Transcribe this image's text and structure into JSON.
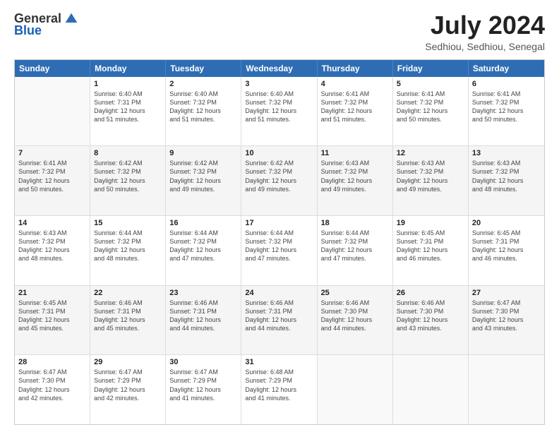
{
  "logo": {
    "general": "General",
    "blue": "Blue"
  },
  "header": {
    "month_year": "July 2024",
    "location": "Sedhiou, Sedhiou, Senegal"
  },
  "days_of_week": [
    "Sunday",
    "Monday",
    "Tuesday",
    "Wednesday",
    "Thursday",
    "Friday",
    "Saturday"
  ],
  "weeks": [
    [
      {
        "day": "",
        "empty": true
      },
      {
        "day": "1",
        "sunrise": "Sunrise: 6:40 AM",
        "sunset": "Sunset: 7:31 PM",
        "daylight": "Daylight: 12 hours and 51 minutes."
      },
      {
        "day": "2",
        "sunrise": "Sunrise: 6:40 AM",
        "sunset": "Sunset: 7:32 PM",
        "daylight": "Daylight: 12 hours and 51 minutes."
      },
      {
        "day": "3",
        "sunrise": "Sunrise: 6:40 AM",
        "sunset": "Sunset: 7:32 PM",
        "daylight": "Daylight: 12 hours and 51 minutes."
      },
      {
        "day": "4",
        "sunrise": "Sunrise: 6:41 AM",
        "sunset": "Sunset: 7:32 PM",
        "daylight": "Daylight: 12 hours and 51 minutes."
      },
      {
        "day": "5",
        "sunrise": "Sunrise: 6:41 AM",
        "sunset": "Sunset: 7:32 PM",
        "daylight": "Daylight: 12 hours and 50 minutes."
      },
      {
        "day": "6",
        "sunrise": "Sunrise: 6:41 AM",
        "sunset": "Sunset: 7:32 PM",
        "daylight": "Daylight: 12 hours and 50 minutes."
      }
    ],
    [
      {
        "day": "7",
        "sunrise": "Sunrise: 6:41 AM",
        "sunset": "Sunset: 7:32 PM",
        "daylight": "Daylight: 12 hours and 50 minutes."
      },
      {
        "day": "8",
        "sunrise": "Sunrise: 6:42 AM",
        "sunset": "Sunset: 7:32 PM",
        "daylight": "Daylight: 12 hours and 50 minutes."
      },
      {
        "day": "9",
        "sunrise": "Sunrise: 6:42 AM",
        "sunset": "Sunset: 7:32 PM",
        "daylight": "Daylight: 12 hours and 49 minutes."
      },
      {
        "day": "10",
        "sunrise": "Sunrise: 6:42 AM",
        "sunset": "Sunset: 7:32 PM",
        "daylight": "Daylight: 12 hours and 49 minutes."
      },
      {
        "day": "11",
        "sunrise": "Sunrise: 6:43 AM",
        "sunset": "Sunset: 7:32 PM",
        "daylight": "Daylight: 12 hours and 49 minutes."
      },
      {
        "day": "12",
        "sunrise": "Sunrise: 6:43 AM",
        "sunset": "Sunset: 7:32 PM",
        "daylight": "Daylight: 12 hours and 49 minutes."
      },
      {
        "day": "13",
        "sunrise": "Sunrise: 6:43 AM",
        "sunset": "Sunset: 7:32 PM",
        "daylight": "Daylight: 12 hours and 48 minutes."
      }
    ],
    [
      {
        "day": "14",
        "sunrise": "Sunrise: 6:43 AM",
        "sunset": "Sunset: 7:32 PM",
        "daylight": "Daylight: 12 hours and 48 minutes."
      },
      {
        "day": "15",
        "sunrise": "Sunrise: 6:44 AM",
        "sunset": "Sunset: 7:32 PM",
        "daylight": "Daylight: 12 hours and 48 minutes."
      },
      {
        "day": "16",
        "sunrise": "Sunrise: 6:44 AM",
        "sunset": "Sunset: 7:32 PM",
        "daylight": "Daylight: 12 hours and 47 minutes."
      },
      {
        "day": "17",
        "sunrise": "Sunrise: 6:44 AM",
        "sunset": "Sunset: 7:32 PM",
        "daylight": "Daylight: 12 hours and 47 minutes."
      },
      {
        "day": "18",
        "sunrise": "Sunrise: 6:44 AM",
        "sunset": "Sunset: 7:32 PM",
        "daylight": "Daylight: 12 hours and 47 minutes."
      },
      {
        "day": "19",
        "sunrise": "Sunrise: 6:45 AM",
        "sunset": "Sunset: 7:31 PM",
        "daylight": "Daylight: 12 hours and 46 minutes."
      },
      {
        "day": "20",
        "sunrise": "Sunrise: 6:45 AM",
        "sunset": "Sunset: 7:31 PM",
        "daylight": "Daylight: 12 hours and 46 minutes."
      }
    ],
    [
      {
        "day": "21",
        "sunrise": "Sunrise: 6:45 AM",
        "sunset": "Sunset: 7:31 PM",
        "daylight": "Daylight: 12 hours and 45 minutes."
      },
      {
        "day": "22",
        "sunrise": "Sunrise: 6:46 AM",
        "sunset": "Sunset: 7:31 PM",
        "daylight": "Daylight: 12 hours and 45 minutes."
      },
      {
        "day": "23",
        "sunrise": "Sunrise: 6:46 AM",
        "sunset": "Sunset: 7:31 PM",
        "daylight": "Daylight: 12 hours and 44 minutes."
      },
      {
        "day": "24",
        "sunrise": "Sunrise: 6:46 AM",
        "sunset": "Sunset: 7:31 PM",
        "daylight": "Daylight: 12 hours and 44 minutes."
      },
      {
        "day": "25",
        "sunrise": "Sunrise: 6:46 AM",
        "sunset": "Sunset: 7:30 PM",
        "daylight": "Daylight: 12 hours and 44 minutes."
      },
      {
        "day": "26",
        "sunrise": "Sunrise: 6:46 AM",
        "sunset": "Sunset: 7:30 PM",
        "daylight": "Daylight: 12 hours and 43 minutes."
      },
      {
        "day": "27",
        "sunrise": "Sunrise: 6:47 AM",
        "sunset": "Sunset: 7:30 PM",
        "daylight": "Daylight: 12 hours and 43 minutes."
      }
    ],
    [
      {
        "day": "28",
        "sunrise": "Sunrise: 6:47 AM",
        "sunset": "Sunset: 7:30 PM",
        "daylight": "Daylight: 12 hours and 42 minutes."
      },
      {
        "day": "29",
        "sunrise": "Sunrise: 6:47 AM",
        "sunset": "Sunset: 7:29 PM",
        "daylight": "Daylight: 12 hours and 42 minutes."
      },
      {
        "day": "30",
        "sunrise": "Sunrise: 6:47 AM",
        "sunset": "Sunset: 7:29 PM",
        "daylight": "Daylight: 12 hours and 41 minutes."
      },
      {
        "day": "31",
        "sunrise": "Sunrise: 6:48 AM",
        "sunset": "Sunset: 7:29 PM",
        "daylight": "Daylight: 12 hours and 41 minutes."
      },
      {
        "day": "",
        "empty": true
      },
      {
        "day": "",
        "empty": true
      },
      {
        "day": "",
        "empty": true
      }
    ]
  ]
}
